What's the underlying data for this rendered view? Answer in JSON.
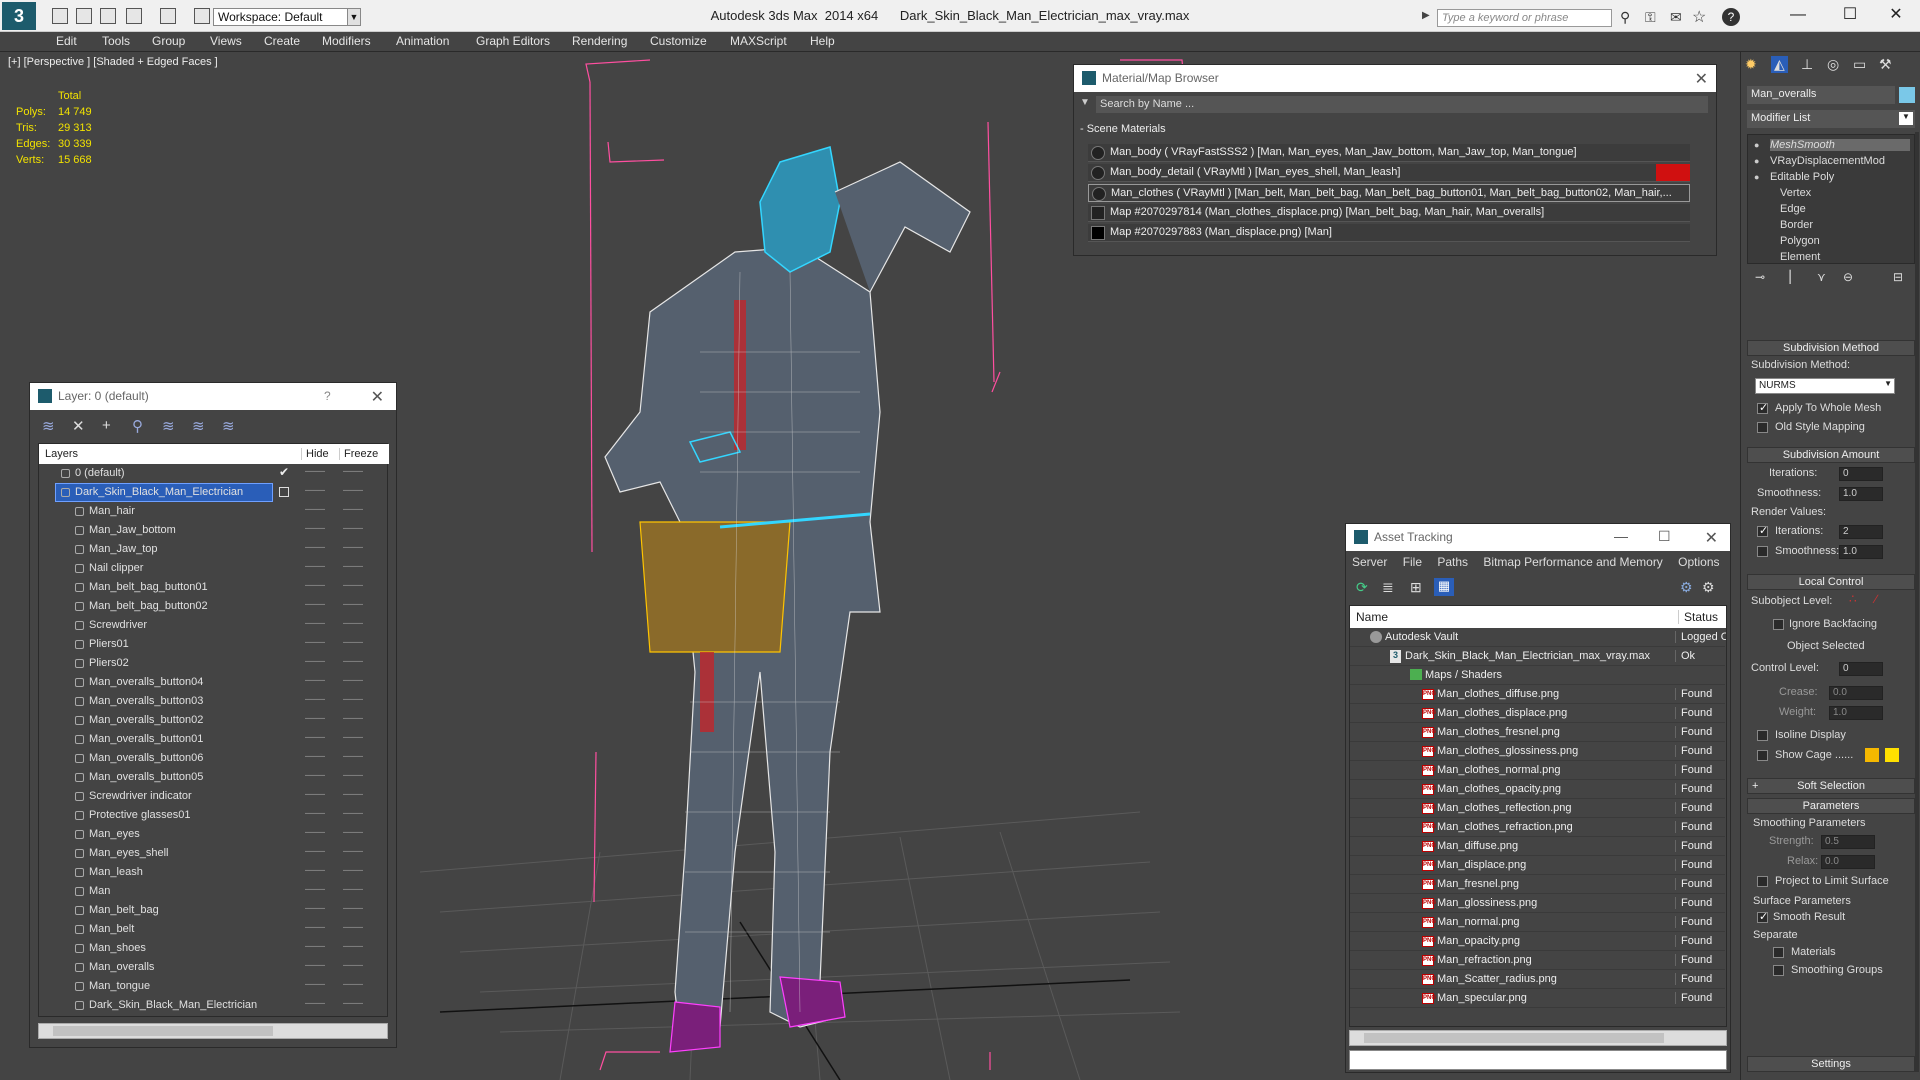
{
  "app": {
    "title": "Autodesk 3ds Max  2014 x64      Dark_Skin_Black_Man_Electrician_max_vray.max",
    "workspace": "Workspace: Default",
    "search_placeholder": "Type a keyword or phrase"
  },
  "menu": [
    "Edit",
    "Tools",
    "Group",
    "Views",
    "Create",
    "Modifiers",
    "Animation",
    "Graph Editors",
    "Rendering",
    "Customize",
    "MAXScript",
    "Help"
  ],
  "viewport": {
    "label": "[+] [Perspective ] [Shaded + Edged Faces ]",
    "stats_header": "Total",
    "stats": [
      {
        "label": "Polys:",
        "value": "14 749"
      },
      {
        "label": "Tris:",
        "value": "29 313"
      },
      {
        "label": "Edges:",
        "value": "30 339"
      },
      {
        "label": "Verts:",
        "value": "15 668"
      }
    ]
  },
  "material_browser": {
    "title": "Material/Map Browser",
    "search_placeholder": "Search by Name ...",
    "section": "- Scene Materials",
    "items": [
      "Man_body  ( VRayFastSSS2 )  [Man, Man_eyes, Man_Jaw_bottom, Man_Jaw_top, Man_tongue]",
      "Man_body_detail  ( VRayMtl )  [Man_eyes_shell, Man_leash]",
      "Man_clothes  ( VRayMtl )  [Man_belt, Man_belt_bag, Man_belt_bag_button01, Man_belt_bag_button02, Man_hair,...",
      "Map #2070297814 (Man_clothes_displace.png)  [Man_belt_bag, Man_hair, Man_overalls]",
      "Map #2070297883 (Man_displace.png)  [Man]"
    ]
  },
  "layer_panel": {
    "title": "Layer: 0 (default)",
    "help": "?",
    "col_layers": "Layers",
    "col_hide": "Hide",
    "col_freeze": "Freeze",
    "rows": [
      {
        "name": "0 (default)",
        "level": 0
      },
      {
        "name": "Dark_Skin_Black_Man_Electrician",
        "level": 0,
        "selected": true
      },
      {
        "name": "Man_hair",
        "level": 1
      },
      {
        "name": "Man_Jaw_bottom",
        "level": 1
      },
      {
        "name": "Man_Jaw_top",
        "level": 1
      },
      {
        "name": "Nail clipper",
        "level": 1
      },
      {
        "name": "Man_belt_bag_button01",
        "level": 1
      },
      {
        "name": "Man_belt_bag_button02",
        "level": 1
      },
      {
        "name": "Screwdriver",
        "level": 1
      },
      {
        "name": "Pliers01",
        "level": 1
      },
      {
        "name": "Pliers02",
        "level": 1
      },
      {
        "name": "Man_overalls_button04",
        "level": 1
      },
      {
        "name": "Man_overalls_button03",
        "level": 1
      },
      {
        "name": "Man_overalls_button02",
        "level": 1
      },
      {
        "name": "Man_overalls_button01",
        "level": 1
      },
      {
        "name": "Man_overalls_button06",
        "level": 1
      },
      {
        "name": "Man_overalls_button05",
        "level": 1
      },
      {
        "name": "Screwdriver indicator",
        "level": 1
      },
      {
        "name": "Protective glasses01",
        "level": 1
      },
      {
        "name": "Man_eyes",
        "level": 1
      },
      {
        "name": "Man_eyes_shell",
        "level": 1
      },
      {
        "name": "Man_leash",
        "level": 1
      },
      {
        "name": "Man",
        "level": 1
      },
      {
        "name": "Man_belt_bag",
        "level": 1
      },
      {
        "name": "Man_belt",
        "level": 1
      },
      {
        "name": "Man_shoes",
        "level": 1
      },
      {
        "name": "Man_overalls",
        "level": 1
      },
      {
        "name": "Man_tongue",
        "level": 1
      },
      {
        "name": "Dark_Skin_Black_Man_Electrician",
        "level": 1
      }
    ]
  },
  "asset_tracking": {
    "title": "Asset Tracking",
    "menu": [
      "Server",
      "File",
      "Paths",
      "Bitmap Performance and Memory",
      "Options"
    ],
    "col_name": "Name",
    "col_status": "Status",
    "rows": [
      {
        "name": "Autodesk Vault",
        "status": "Logged O",
        "indent": 20,
        "kind": "vault"
      },
      {
        "name": "Dark_Skin_Black_Man_Electrician_max_vray.max",
        "status": "Ok",
        "indent": 40,
        "kind": "max"
      },
      {
        "name": "Maps / Shaders",
        "status": "",
        "indent": 60,
        "kind": "folder"
      },
      {
        "name": "Man_clothes_diffuse.png",
        "status": "Found",
        "indent": 72,
        "kind": "png"
      },
      {
        "name": "Man_clothes_displace.png",
        "status": "Found",
        "indent": 72,
        "kind": "png"
      },
      {
        "name": "Man_clothes_fresnel.png",
        "status": "Found",
        "indent": 72,
        "kind": "png"
      },
      {
        "name": "Man_clothes_glossiness.png",
        "status": "Found",
        "indent": 72,
        "kind": "png"
      },
      {
        "name": "Man_clothes_normal.png",
        "status": "Found",
        "indent": 72,
        "kind": "png"
      },
      {
        "name": "Man_clothes_opacity.png",
        "status": "Found",
        "indent": 72,
        "kind": "png"
      },
      {
        "name": "Man_clothes_reflection.png",
        "status": "Found",
        "indent": 72,
        "kind": "png"
      },
      {
        "name": "Man_clothes_refraction.png",
        "status": "Found",
        "indent": 72,
        "kind": "png"
      },
      {
        "name": "Man_diffuse.png",
        "status": "Found",
        "indent": 72,
        "kind": "png"
      },
      {
        "name": "Man_displace.png",
        "status": "Found",
        "indent": 72,
        "kind": "png"
      },
      {
        "name": "Man_fresnel.png",
        "status": "Found",
        "indent": 72,
        "kind": "png"
      },
      {
        "name": "Man_glossiness.png",
        "status": "Found",
        "indent": 72,
        "kind": "png"
      },
      {
        "name": "Man_normal.png",
        "status": "Found",
        "indent": 72,
        "kind": "png"
      },
      {
        "name": "Man_opacity.png",
        "status": "Found",
        "indent": 72,
        "kind": "png"
      },
      {
        "name": "Man_refraction.png",
        "status": "Found",
        "indent": 72,
        "kind": "png"
      },
      {
        "name": "Man_Scatter_radius.png",
        "status": "Found",
        "indent": 72,
        "kind": "png"
      },
      {
        "name": "Man_specular.png",
        "status": "Found",
        "indent": 72,
        "kind": "png"
      }
    ]
  },
  "command_panel": {
    "object_name": "Man_overalls",
    "modifier_list": "Modifier List",
    "stack": [
      {
        "name": "MeshSmooth",
        "indent": 0,
        "italic": true
      },
      {
        "name": "VRayDisplacementMod",
        "indent": 0
      },
      {
        "name": "Editable Poly",
        "indent": 0
      },
      {
        "name": "Vertex",
        "indent": 1
      },
      {
        "name": "Edge",
        "indent": 1
      },
      {
        "name": "Border",
        "indent": 1
      },
      {
        "name": "Polygon",
        "indent": 1
      },
      {
        "name": "Element",
        "indent": 1
      }
    ],
    "subdivision_method": {
      "header": "Subdivision Method",
      "label": "Subdivision Method:",
      "value": "NURMS",
      "apply_whole": "Apply To Whole Mesh",
      "old_style": "Old Style Mapping"
    },
    "subdivision_amount": {
      "header": "Subdivision Amount",
      "iterations_label": "Iterations:",
      "iterations": "0",
      "smoothness_label": "Smoothness:",
      "smoothness": "1.0",
      "render_values": "Render Values:",
      "r_iterations": "2",
      "r_smoothness": "1.0"
    },
    "local_control": {
      "header": "Local Control",
      "subobject": "Subobject Level:",
      "ignore_backfacing": "Ignore Backfacing",
      "object_selected": "Object Selected",
      "control_level": "Control Level:",
      "control_level_value": "0",
      "crease": "Crease:",
      "crease_value": "0.0",
      "weight": "Weight:",
      "weight_value": "1.0",
      "isoline": "Isoline Display",
      "show_cage": "Show Cage ......"
    },
    "soft_selection": "Soft Selection",
    "parameters": {
      "header": "Parameters",
      "smoothing": "Smoothing Parameters",
      "strength": "Strength:",
      "strength_value": "0.5",
      "relax": "Relax:",
      "relax_value": "0.0",
      "project": "Project to Limit Surface",
      "surface": "Surface Parameters",
      "smooth_result": "Smooth Result",
      "separate": "Separate",
      "materials": "Materials",
      "smoothing_groups": "Smoothing Groups"
    },
    "settings": "Settings"
  },
  "colors": {
    "accent": "#1e90ff",
    "selection": "#2a5eb8",
    "stats": "#f2e200",
    "wire": "#ffffff",
    "cyan": "#33d6ff"
  }
}
